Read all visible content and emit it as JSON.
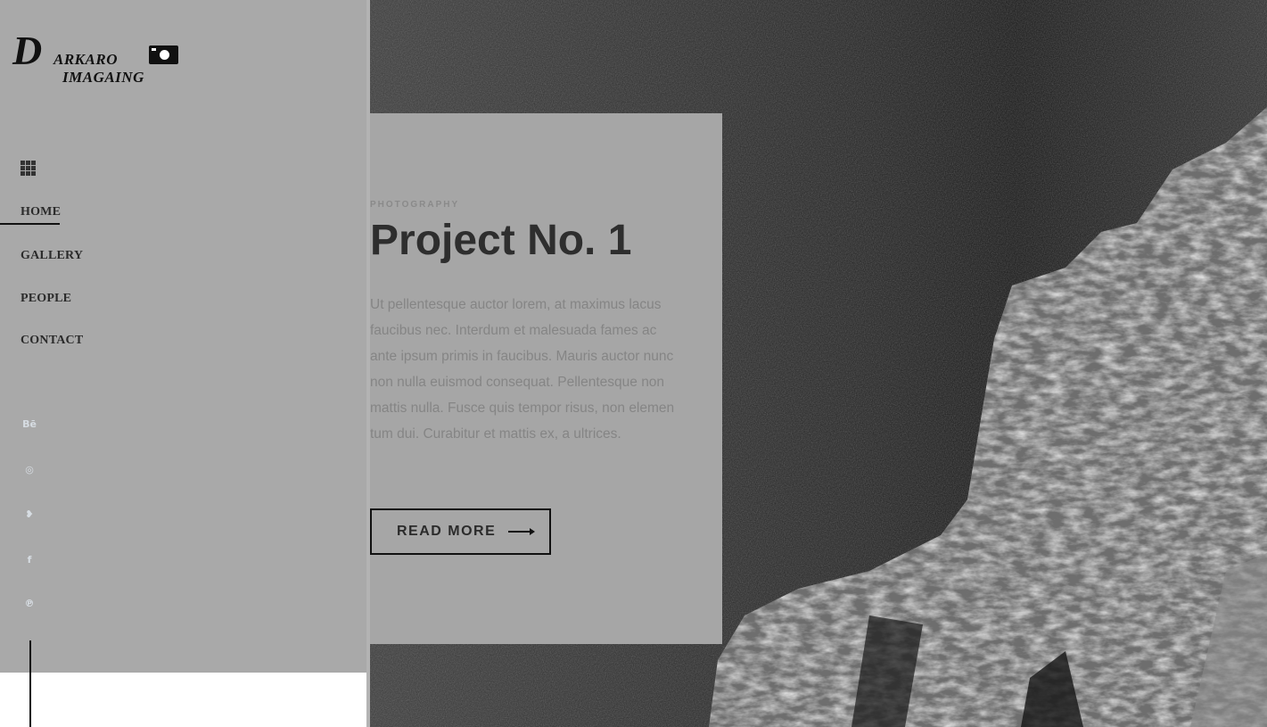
{
  "brand": {
    "logo_initial": "D",
    "logo_line1": "ARKARO",
    "logo_line2": "IMAGAING"
  },
  "nav": {
    "menu_icon": "grid-icon",
    "items": [
      {
        "label": "HOME",
        "active": true
      },
      {
        "label": "GALLERY",
        "active": false
      },
      {
        "label": "PEOPLE",
        "active": false
      },
      {
        "label": "CONTACT",
        "active": false
      }
    ]
  },
  "social": [
    {
      "icon": "behance-icon",
      "glyph": "Bē"
    },
    {
      "icon": "dribbble-icon",
      "glyph": "◎"
    },
    {
      "icon": "twitter-icon",
      "glyph": "❥"
    },
    {
      "icon": "facebook-icon",
      "glyph": "f"
    },
    {
      "icon": "pinterest-icon",
      "glyph": "℗"
    }
  ],
  "project": {
    "category": "PHOTOGRAPHY",
    "title": "Project No. 1",
    "description": "Ut pellentesque auctor lorem, at maximus lacus faucibus nec. Interdum et malesuada fames ac ante ipsum primis in faucibus. Mauris auctor nunc non nulla euismod consequat. Pellentesque non mattis nulla. Fusce quis tempor risus, non elemen tum dui. Curabitur et mattis ex, a ultrices.",
    "button_label": "READ MORE"
  },
  "colors": {
    "sidebar_bg": "#a9a9a9",
    "card_bg": "#a6a6a6",
    "text_dark": "#2b2b2b",
    "text_muted": "#858585"
  }
}
